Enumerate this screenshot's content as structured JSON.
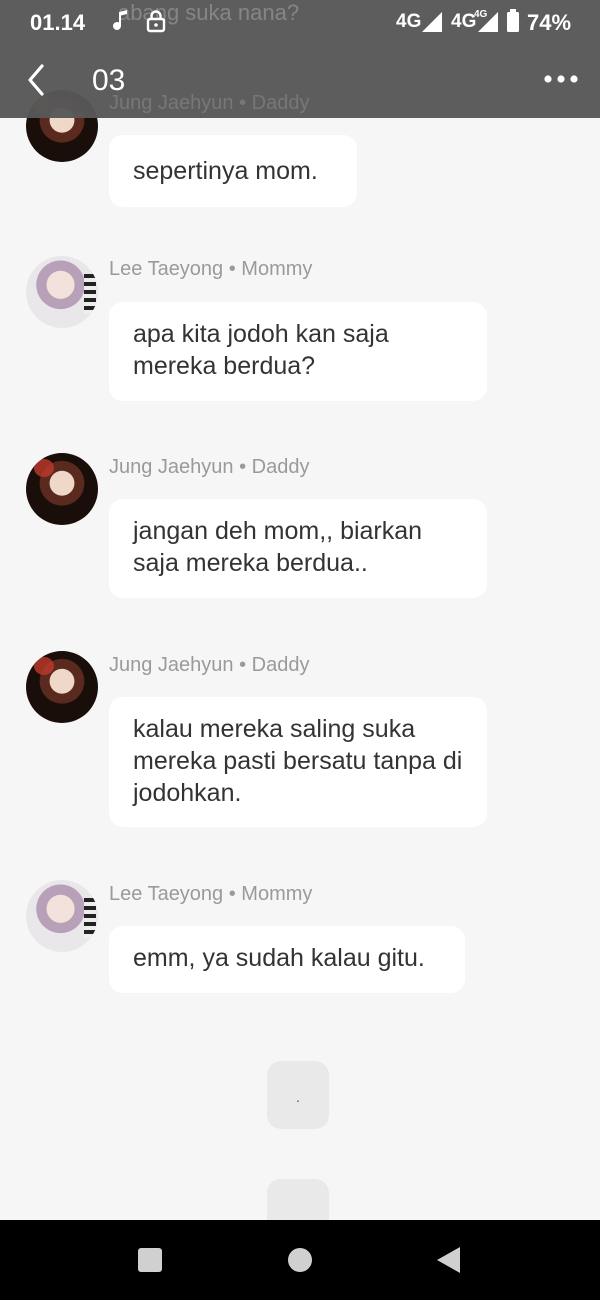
{
  "status_bar": {
    "time": "01.14",
    "network_1": "4G",
    "network_2": "4G",
    "network_2_sup": "4G",
    "battery": "74%"
  },
  "header": {
    "title": "03",
    "ghost_text": "abang suka nana?",
    "ghost_sender": "Jung Jaehyun • Daddy"
  },
  "messages": [
    {
      "sender": "",
      "text": "sepertinya mom.",
      "avatar": "daddy"
    },
    {
      "sender": "Lee Taeyong • Mommy",
      "text": "apa kita jodoh kan saja mereka berdua?",
      "avatar": "mommy"
    },
    {
      "sender": "Jung Jaehyun • Daddy",
      "text": "jangan deh mom,, biarkan saja mereka berdua..",
      "avatar": "daddy"
    },
    {
      "sender": "Jung Jaehyun • Daddy",
      "text": "kalau mereka saling suka mereka pasti bersatu tanpa di jodohkan.",
      "avatar": "daddy"
    },
    {
      "sender": "Lee Taeyong • Mommy",
      "text": "emm, ya sudah kalau gitu.",
      "avatar": "mommy"
    }
  ],
  "pending": [
    {
      "text": "."
    },
    {
      "text": ""
    }
  ],
  "icons": {
    "music": "music-note-icon",
    "lock": "lock-icon",
    "back": "chevron-left-icon",
    "more": "more-dots-icon",
    "nav_recents": "square-icon",
    "nav_home": "circle-icon",
    "nav_back": "triangle-back-icon"
  }
}
